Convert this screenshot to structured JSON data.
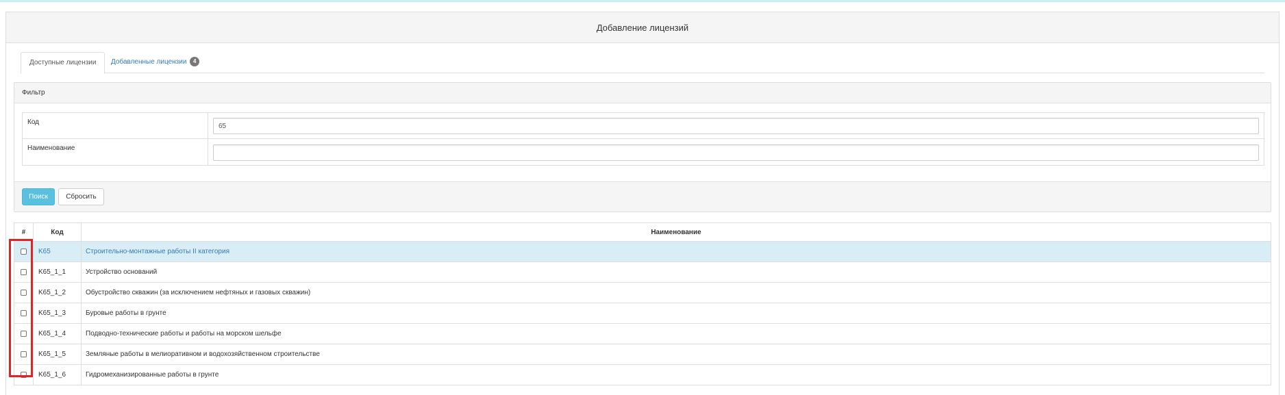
{
  "panel": {
    "title": "Добавление лицензий"
  },
  "tabs": [
    {
      "label": "Доступные лицензии",
      "active": true
    },
    {
      "label": "Добавленные лицензии",
      "badge": "4",
      "active": false
    }
  ],
  "filter": {
    "title": "Фильтр",
    "fields": [
      {
        "label": "Код",
        "value": "65",
        "placeholder": ""
      },
      {
        "label": "Наименование",
        "value": "",
        "placeholder": ""
      }
    ],
    "search_label": "Поиск",
    "reset_label": "Сбросить"
  },
  "table": {
    "columns": [
      "#",
      "Код",
      "Наименование"
    ],
    "rows": [
      {
        "code": "K65",
        "name": "Строительно-монтажные работы II категория",
        "highlighted": true,
        "checked": false
      },
      {
        "code": "K65_1_1",
        "name": "Устройство оснований",
        "highlighted": false,
        "checked": false
      },
      {
        "code": "K65_1_2",
        "name": "Обустройство скважин (за исключением нефтяных и газовых скважин)",
        "highlighted": false,
        "checked": false
      },
      {
        "code": "K65_1_3",
        "name": "Буровые работы в грунте",
        "highlighted": false,
        "checked": false
      },
      {
        "code": "K65_1_4",
        "name": "Подводно-технические работы и работы на морском шельфе",
        "highlighted": false,
        "checked": false
      },
      {
        "code": "K65_1_5",
        "name": "Земляные работы в мелиоративном и водохозяйственном строительстве",
        "highlighted": false,
        "checked": false
      },
      {
        "code": "K65_1_6",
        "name": "Гидромеханизированные работы в грунте",
        "highlighted": false,
        "checked": false
      }
    ]
  },
  "colors": {
    "accent": "#5bc0de",
    "link": "#337ab7",
    "highlight_row": "#d9edf7",
    "annotation": "#e02424"
  }
}
